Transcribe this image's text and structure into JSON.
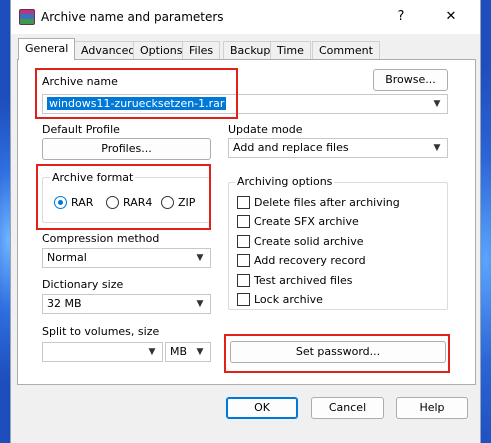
{
  "window": {
    "title": "Archive name and parameters",
    "help_glyph": "?",
    "close_glyph": "✕"
  },
  "tabs": [
    {
      "label": "General",
      "active": true
    },
    {
      "label": "Advanced"
    },
    {
      "label": "Options"
    },
    {
      "label": "Files"
    },
    {
      "label": "Backup"
    },
    {
      "label": "Time"
    },
    {
      "label": "Comment"
    }
  ],
  "archive_name": {
    "label": "Archive name",
    "browse_label": "Browse...",
    "value": "windows11-zuruecksetzen-1.rar"
  },
  "default_profile": {
    "label": "Default Profile",
    "button_label": "Profiles..."
  },
  "update_mode": {
    "label": "Update mode",
    "value": "Add and replace files"
  },
  "archive_format": {
    "label": "Archive format",
    "options": [
      "RAR",
      "RAR4",
      "ZIP"
    ],
    "selected": "RAR"
  },
  "compression_method": {
    "label": "Compression method",
    "value": "Normal"
  },
  "dictionary_size": {
    "label": "Dictionary size",
    "value": "32 MB"
  },
  "split_volumes": {
    "label": "Split to volumes, size",
    "value": "",
    "unit": "MB"
  },
  "archiving_options": {
    "label": "Archiving options",
    "items": [
      {
        "label": "Delete files after archiving",
        "checked": false
      },
      {
        "label": "Create SFX archive",
        "checked": false
      },
      {
        "label": "Create solid archive",
        "checked": false
      },
      {
        "label": "Add recovery record",
        "checked": false
      },
      {
        "label": "Test archived files",
        "checked": false
      },
      {
        "label": "Lock archive",
        "checked": false
      }
    ]
  },
  "set_password_label": "Set password...",
  "footer": {
    "ok_label": "OK",
    "cancel_label": "Cancel",
    "help_label": "Help"
  },
  "annotation_color": "#e0201a",
  "accent_color": "#0078d7",
  "icons": {
    "app": "winrar-app-icon",
    "dropdown": "chevron-down-icon"
  }
}
